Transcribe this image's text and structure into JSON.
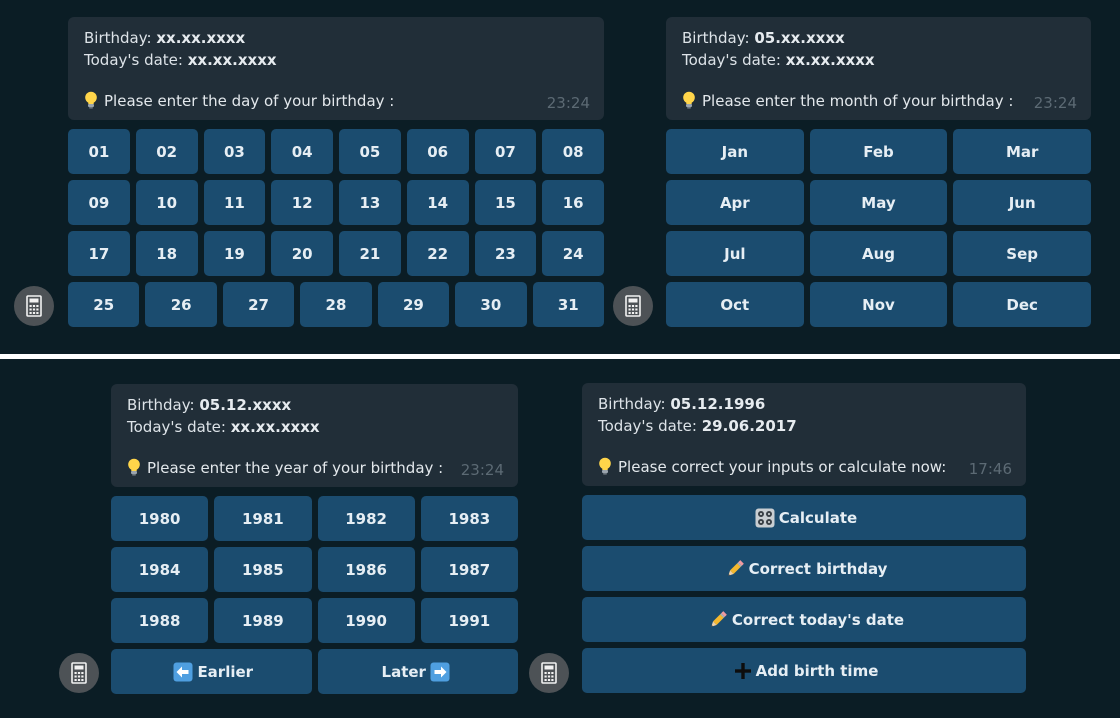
{
  "panel_day": {
    "birthday_label": "Birthday:",
    "birthday_value": "xx.xx.xxxx",
    "today_label": "Today's date:",
    "today_value": "xx.xx.xxxx",
    "prompt": "Please enter the day of your birthday :",
    "time": "23:24",
    "keys_row1": [
      "01",
      "02",
      "03",
      "04",
      "05",
      "06",
      "07",
      "08"
    ],
    "keys_row2": [
      "09",
      "10",
      "11",
      "12",
      "13",
      "14",
      "15",
      "16"
    ],
    "keys_row3": [
      "17",
      "18",
      "19",
      "20",
      "21",
      "22",
      "23",
      "24"
    ],
    "keys_row4": [
      "25",
      "26",
      "27",
      "28",
      "29",
      "30",
      "31"
    ]
  },
  "panel_month": {
    "birthday_label": "Birthday:",
    "birthday_value": "05.xx.xxxx",
    "today_label": "Today's date:",
    "today_value": "xx.xx.xxxx",
    "prompt": "Please enter the month of your birthday :",
    "time": "23:24",
    "keys": [
      "Jan",
      "Feb",
      "Mar",
      "Apr",
      "May",
      "Jun",
      "Jul",
      "Aug",
      "Sep",
      "Oct",
      "Nov",
      "Dec"
    ]
  },
  "panel_year": {
    "birthday_label": "Birthday:",
    "birthday_value": "05.12.xxxx",
    "today_label": "Today's date:",
    "today_value": "xx.xx.xxxx",
    "prompt": "Please enter the year of your birthday :",
    "time": "23:24",
    "keys": [
      "1980",
      "1981",
      "1982",
      "1983",
      "1984",
      "1985",
      "1986",
      "1987",
      "1988",
      "1989",
      "1990",
      "1991"
    ],
    "earlier_label": "Earlier",
    "later_label": "Later"
  },
  "panel_actions": {
    "birthday_label": "Birthday:",
    "birthday_value": "05.12.1996",
    "today_label": "Today's date:",
    "today_value": "29.06.2017",
    "prompt": "Please correct your inputs or calculate now:",
    "time": "17:46",
    "buttons": [
      "Calculate",
      "Correct birthday",
      "Correct today's date",
      "Add birth time"
    ]
  },
  "icons": {
    "bulb": "light-bulb-icon",
    "calculator": "calculator-icon",
    "left_arrow": "left-arrow-icon",
    "right_arrow": "right-arrow-icon",
    "control_knobs": "control-knobs-icon",
    "pencil": "pencil-icon",
    "plus": "plus-icon"
  },
  "colors": {
    "background": "#0b1d25",
    "bubble": "#212e38",
    "button": "#1b4c6f",
    "divider": "#ffffff"
  }
}
